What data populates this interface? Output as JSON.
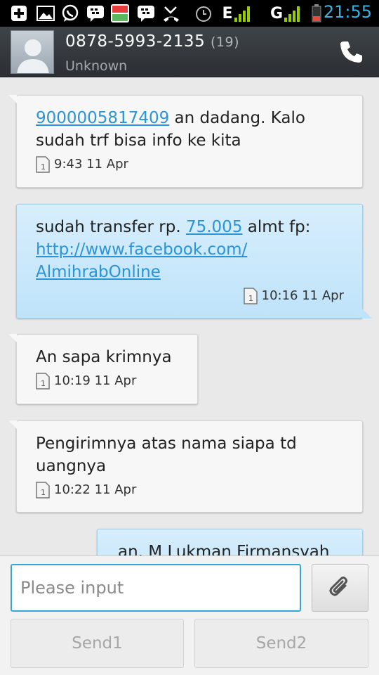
{
  "status_bar": {
    "time": "21:55",
    "network_label_1": "E",
    "network_label_2": "G",
    "icons": [
      "add-icon",
      "image-icon",
      "whatsapp-icon",
      "bbm-icon",
      "qoo10-icon",
      "bbm-icon",
      "missed-call-icon",
      "alarm-icon",
      "signal-icon",
      "battery-icon"
    ]
  },
  "header": {
    "contact_number": "0878-5993-2135",
    "thread_count": "(19)",
    "contact_status": "Unknown"
  },
  "messages": [
    {
      "direction": "incoming",
      "link_text": "9000005817409",
      "text": " an dadang. Kalo sudah trf bisa info ke kita",
      "time": "9:43 11 Apr"
    },
    {
      "direction": "outgoing",
      "text_before": "sudah transfer rp. ",
      "amount_link": "75.005",
      "text_middle": " almt fp:",
      "url_line1": "http://www.facebook.com/",
      "url_line2": "AlmihrabOnline",
      "time": "10:16 11 Apr"
    },
    {
      "direction": "incoming",
      "text": "An sapa krimnya",
      "time": "10:19 11 Apr"
    },
    {
      "direction": "incoming",
      "text": "Pengirimnya atas nama siapa td uangnya",
      "time": "10:22 11 Apr"
    },
    {
      "direction": "outgoing",
      "text": "an. M Lukman Firmansyah"
    }
  ],
  "compose": {
    "placeholder": "Please input",
    "value": "",
    "send1_label": "Send1",
    "send2_label": "Send2"
  },
  "colors": {
    "accent": "#33b5e5",
    "link": "#2a94d6",
    "outgoing_bubble": "#c9e8fb",
    "incoming_bubble": "#f7f7f7"
  }
}
